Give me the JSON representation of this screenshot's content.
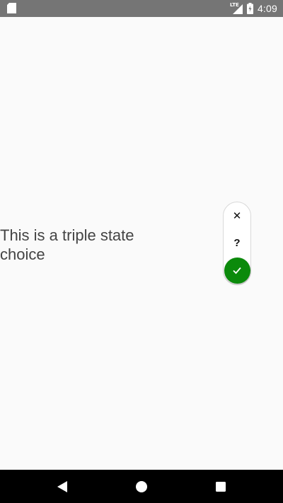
{
  "status_bar": {
    "network": "LTE",
    "time": "4:09",
    "icons": [
      "sd-card-icon",
      "signal-icon",
      "battery-icon"
    ]
  },
  "main": {
    "label": "This is a triple state choice",
    "triple_switch": {
      "options": [
        {
          "name": "no",
          "symbol": "✕"
        },
        {
          "name": "maybe",
          "symbol": "?"
        },
        {
          "name": "yes",
          "symbol": "✓"
        }
      ],
      "selected": "yes",
      "selected_color": "#0b8a0b"
    }
  },
  "nav_bar": {
    "buttons": [
      "back-icon",
      "home-icon",
      "recents-icon"
    ]
  }
}
